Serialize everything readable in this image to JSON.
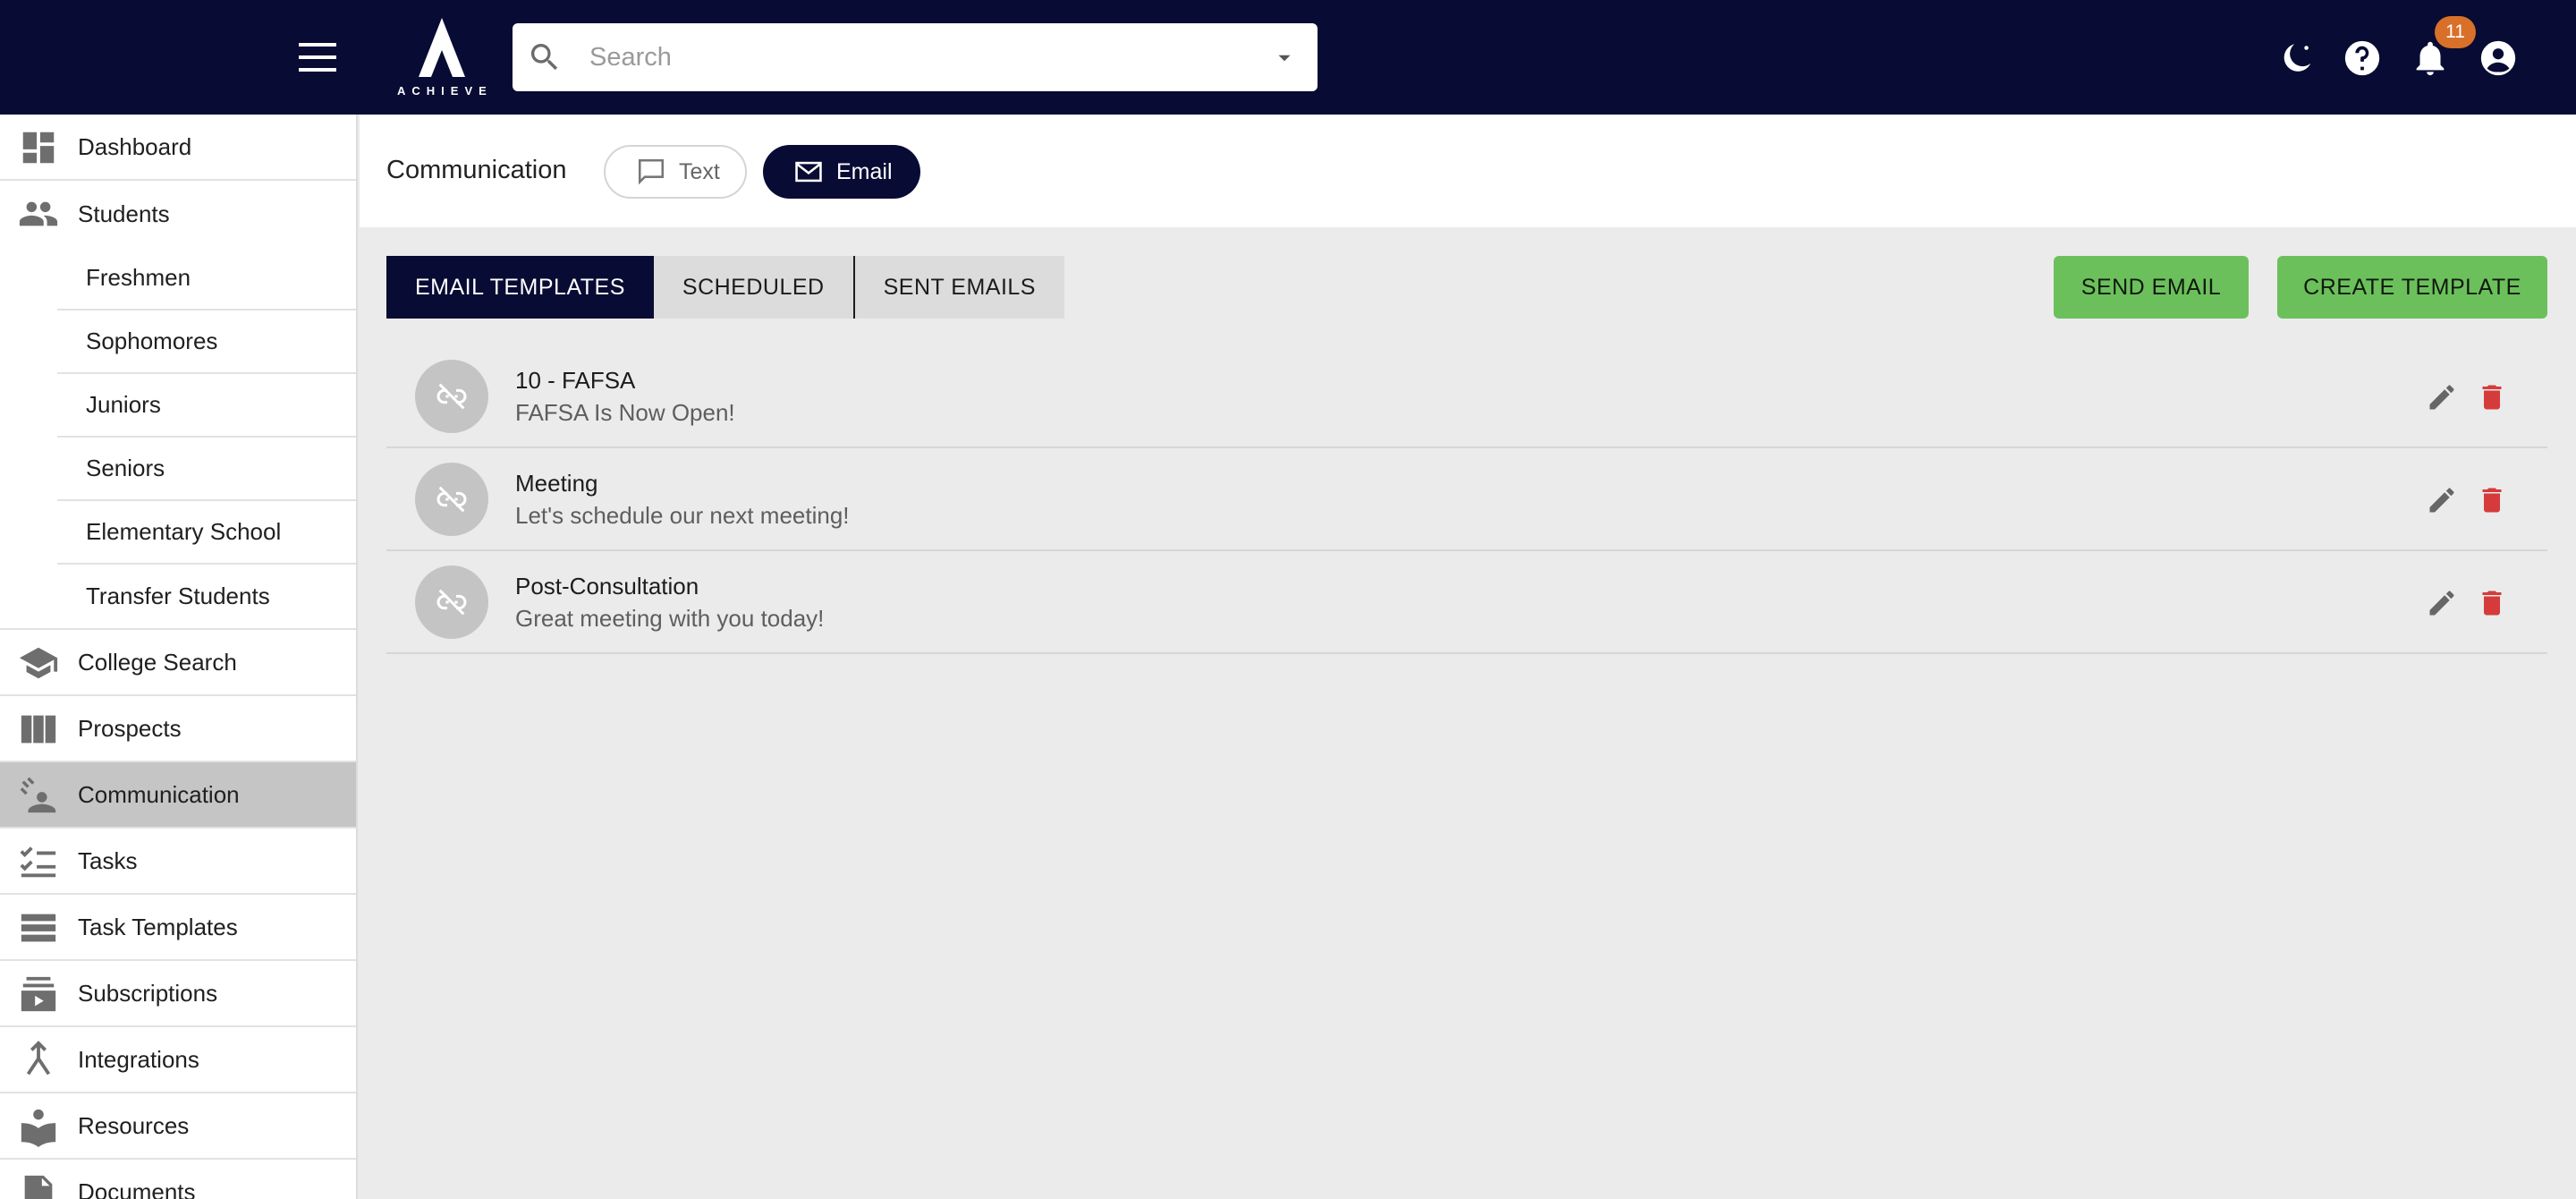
{
  "topbar": {
    "logo_text": "ACHIEVE",
    "search_placeholder": "Search",
    "notification_count": "11",
    "icons": [
      "menu-icon",
      "search-icon",
      "dropdown-caret-icon",
      "dark-mode-icon",
      "help-icon",
      "bell-icon",
      "account-icon"
    ]
  },
  "sidebar": {
    "items": [
      {
        "label": "Dashboard",
        "icon": "dashboard-icon"
      },
      {
        "label": "Students",
        "icon": "people-icon"
      },
      {
        "label": "College Search",
        "icon": "school-icon"
      },
      {
        "label": "Prospects",
        "icon": "columns-icon"
      },
      {
        "label": "Communication",
        "icon": "communication-icon",
        "active": true
      },
      {
        "label": "Tasks",
        "icon": "checklist-icon"
      },
      {
        "label": "Task Templates",
        "icon": "list-icon"
      },
      {
        "label": "Subscriptions",
        "icon": "subscriptions-icon"
      },
      {
        "label": "Integrations",
        "icon": "merge-icon"
      },
      {
        "label": "Resources",
        "icon": "book-icon"
      },
      {
        "label": "Documents",
        "icon": "document-icon"
      }
    ],
    "student_groups": [
      "Freshmen",
      "Sophomores",
      "Juniors",
      "Seniors",
      "Elementary School",
      "Transfer Students"
    ]
  },
  "header": {
    "title": "Communication",
    "chip_text": "Text",
    "chip_email": "Email"
  },
  "tabs": [
    "EMAIL TEMPLATES",
    "SCHEDULED",
    "SENT EMAILS"
  ],
  "actions": {
    "send": "SEND EMAIL",
    "create": "CREATE TEMPLATE"
  },
  "templates": [
    {
      "title": "10 - FAFSA",
      "subject": "FAFSA Is Now Open!"
    },
    {
      "title": "Meeting",
      "subject": "Let's schedule our next meeting!"
    },
    {
      "title": "Post-Consultation",
      "subject": "Great meeting with you today!"
    }
  ],
  "colors": {
    "topbar": "#080b33",
    "accent_green": "#6cc05c",
    "delete_red": "#d63b3b",
    "badge_orange": "#d8702a"
  }
}
